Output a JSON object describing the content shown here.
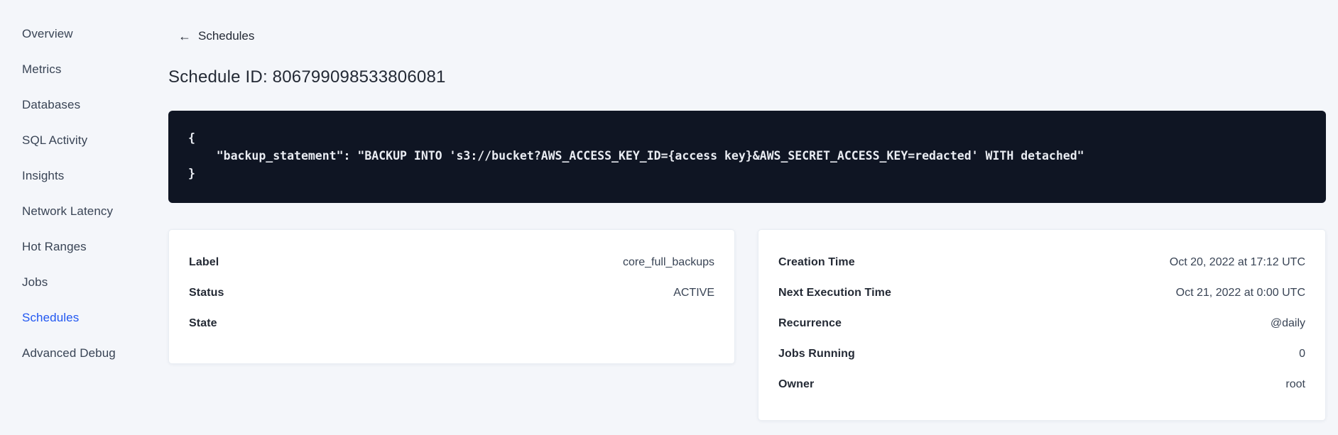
{
  "sidebar": {
    "items": [
      {
        "label": "Overview",
        "active": false
      },
      {
        "label": "Metrics",
        "active": false
      },
      {
        "label": "Databases",
        "active": false
      },
      {
        "label": "SQL Activity",
        "active": false
      },
      {
        "label": "Insights",
        "active": false
      },
      {
        "label": "Network Latency",
        "active": false
      },
      {
        "label": "Hot Ranges",
        "active": false
      },
      {
        "label": "Jobs",
        "active": false
      },
      {
        "label": "Schedules",
        "active": true
      },
      {
        "label": "Advanced Debug",
        "active": false
      }
    ]
  },
  "header": {
    "back_icon": "←",
    "back_label": "Schedules",
    "title": "Schedule ID: 806799098533806081"
  },
  "code_block": {
    "lines": [
      "{",
      "    \"backup_statement\": \"BACKUP INTO 's3://bucket?AWS_ACCESS_KEY_ID={access key}&AWS_SECRET_ACCESS_KEY=redacted' WITH detached\"",
      "}"
    ]
  },
  "details_card": {
    "rows": [
      {
        "label": "Label",
        "value": "core_full_backups"
      },
      {
        "label": "Status",
        "value": "ACTIVE"
      },
      {
        "label": "State",
        "value": ""
      }
    ]
  },
  "schedule_card": {
    "rows": [
      {
        "label": "Creation Time",
        "value": "Oct 20, 2022 at 17:12 UTC"
      },
      {
        "label": "Next Execution Time",
        "value": "Oct 21, 2022 at 0:00 UTC"
      },
      {
        "label": "Recurrence",
        "value": "@daily"
      },
      {
        "label": "Jobs Running",
        "value": "0"
      },
      {
        "label": "Owner",
        "value": "root"
      }
    ]
  },
  "colors": {
    "background": "#f4f6fa",
    "accent_blue": "#2157f1",
    "code_background": "#0f1523",
    "code_text": "#e9ecf2",
    "text_dark": "#242a35",
    "text_muted": "#394455"
  }
}
